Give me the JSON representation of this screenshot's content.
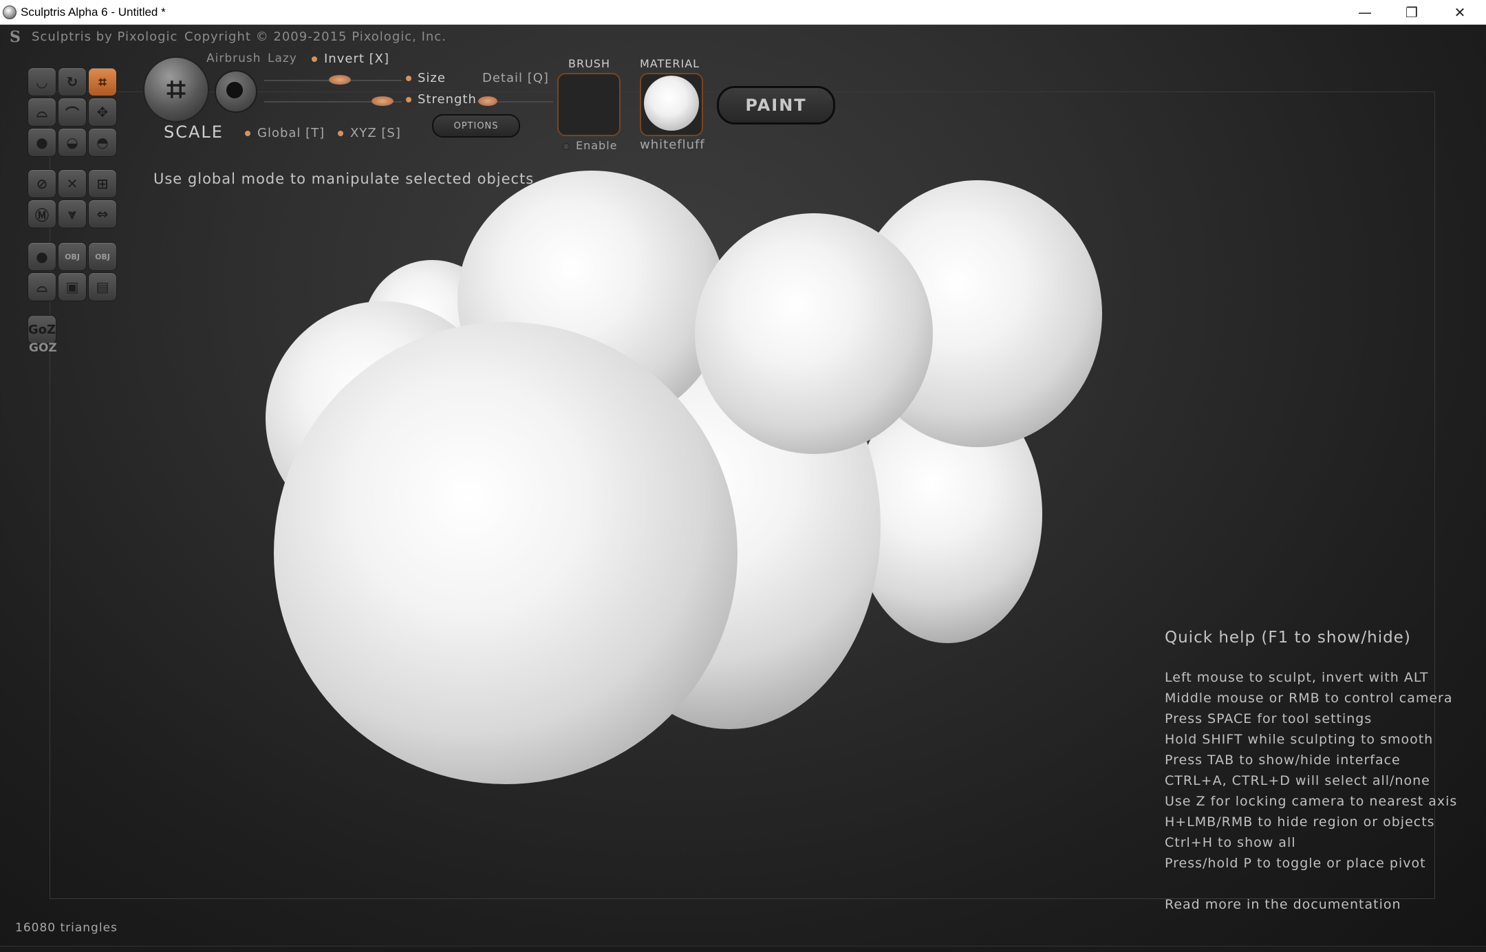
{
  "window": {
    "title": "Sculptris Alpha 6 - Untitled *",
    "minimize_glyph": "—",
    "maximize_glyph": "❐",
    "close_glyph": "✕"
  },
  "header": {
    "logo_glyph": "S",
    "app_name": "Sculptris by Pixologic",
    "copyright": "Copyright © 2009-2015 Pixologic, Inc."
  },
  "toolbar": {
    "tool_name": "SCALE",
    "airbrush_label": "Airbrush",
    "lazy_label": "Lazy",
    "invert_label": "Invert [X]",
    "size_label": "Size",
    "strength_label": "Strength",
    "detail_label": "Detail [Q]",
    "global_label": "Global [T]",
    "xyz_label": "XYZ [S]",
    "options_label": "OPTIONS",
    "brush_heading": "BRUSH",
    "brush_enable_label": "Enable",
    "material_heading": "MATERIAL",
    "material_name": "whitefluff",
    "paint_label": "PAINT",
    "goz_label": "GOZ",
    "goz_button_text": "GoZ"
  },
  "hint_text": "Use global mode to manipulate selected objects",
  "quick_help": {
    "title": "Quick help (F1 to show/hide)",
    "lines": [
      "Left mouse to sculpt, invert with ALT",
      "Middle mouse or RMB to control camera",
      "Press SPACE for tool settings",
      "Hold SHIFT while sculpting to smooth",
      "Press TAB to show/hide interface",
      "CTRL+A, CTRL+D will select all/none",
      "Use Z for locking camera to nearest axis",
      "H+LMB/RMB to hide region or objects",
      "Ctrl+H to show all",
      "Press/hold P to toggle or place pivot"
    ],
    "footer": "Read more in the documentation"
  },
  "status": {
    "triangles": "16080 triangles"
  },
  "colors": {
    "accent": "#d6925f",
    "active_tool": "#c8723a"
  }
}
